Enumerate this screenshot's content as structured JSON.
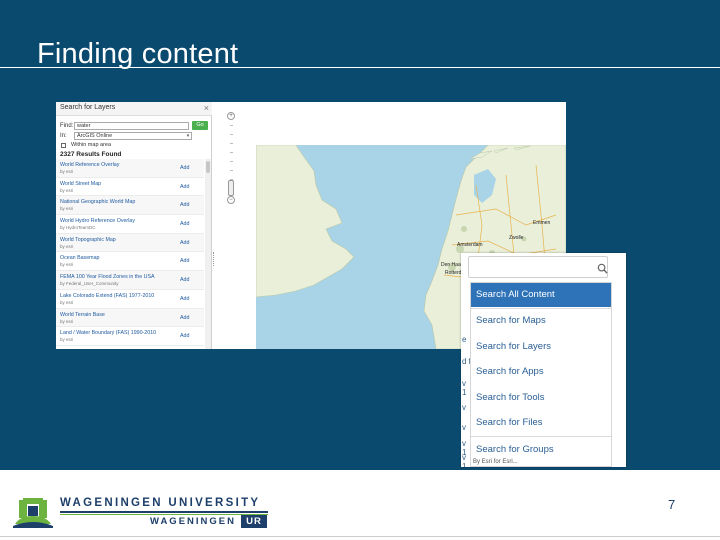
{
  "slide": {
    "title": "Finding content",
    "page_number": "7",
    "background_color": "#0b4a6f"
  },
  "layer_panel": {
    "title": "Search for Layers",
    "close_icon": "close-icon",
    "find_label": "Find:",
    "find_value": "water",
    "go_label": "Go",
    "in_label": "In:",
    "in_value": "ArcGIS Online",
    "within_map_label": "Within map area",
    "results_count": "2327 Results Found",
    "add_label": "Add",
    "results": [
      {
        "name": "World Reference Overlay",
        "by": "by esri"
      },
      {
        "name": "World Street Map",
        "by": "by esri"
      },
      {
        "name": "National Geographic World Map",
        "by": "by esri"
      },
      {
        "name": "World Hydro Reference Overlay",
        "by": "by HydroTeamDC"
      },
      {
        "name": "World Topographic Map",
        "by": "by esri"
      },
      {
        "name": "Ocean Basemap",
        "by": "by esri"
      },
      {
        "name": "FEMA 100 Year Flood Zones in the USA",
        "by": "by Federal_User_Community"
      },
      {
        "name": "Lake Colorado Extend (FAS) 1977-2010",
        "by": "by esri"
      },
      {
        "name": "World Terrain Base",
        "by": "by esri"
      },
      {
        "name": "Land / Water Boundary (FAS) 1990-2010",
        "by": "by esri"
      }
    ]
  },
  "map": {
    "labels": [
      "Amsterdam",
      "Emmen",
      "Zwolle",
      "Den Haag",
      "Rotterdam"
    ],
    "water_color": "#a9d3e6",
    "land_color": "#e9efd9"
  },
  "search_dropdown": {
    "search_icon": "search-icon",
    "items": [
      "Search All Content",
      "Search for Maps",
      "Search for Layers",
      "Search for Apps",
      "Search for Tools",
      "Search for Files",
      "Search for Groups"
    ],
    "active_color": "#2e73b8",
    "background_glyphs": [
      "e",
      "d f",
      "v 1",
      "v",
      "v",
      "v 1",
      "v 1"
    ],
    "bottom_text": "By Esri    for Esri..."
  },
  "footer": {
    "university_name": "WAGENINGEN UNIVERSITY",
    "wordmark": "WAGENINGEN",
    "wordmark_ur": "UR",
    "logo_icon": "wur-logo-icon",
    "brand_blue": "#1d3f6a",
    "brand_green": "#6db33f"
  }
}
